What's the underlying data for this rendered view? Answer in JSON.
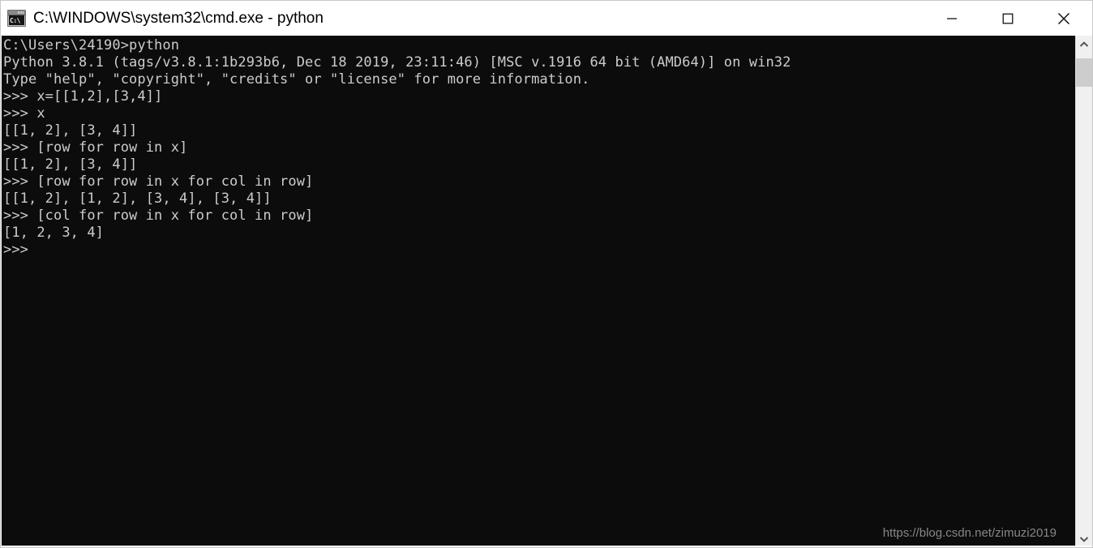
{
  "window": {
    "title": "C:\\WINDOWS\\system32\\cmd.exe - python",
    "icon_name": "cmd-exe-icon",
    "icon_glyph": "C:\\",
    "background_color": "#0c0c0c",
    "text_color": "#cccccc",
    "titlebar_color": "#ffffff"
  },
  "controls": {
    "minimize_label": "Minimize",
    "maximize_label": "Maximize",
    "close_label": "Close"
  },
  "console": {
    "lines": [
      "C:\\Users\\24190>python",
      "Python 3.8.1 (tags/v3.8.1:1b293b6, Dec 18 2019, 23:11:46) [MSC v.1916 64 bit (AMD64)] on win32",
      "Type \"help\", \"copyright\", \"credits\" or \"license\" for more information.",
      ">>> x=[[1,2],[3,4]]",
      ">>> x",
      "[[1, 2], [3, 4]]",
      ">>> [row for row in x]",
      "[[1, 2], [3, 4]]",
      ">>> [row for row in x for col in row]",
      "[[1, 2], [1, 2], [3, 4], [3, 4]]",
      ">>> [col for row in x for col in row]",
      "[1, 2, 3, 4]",
      ">>>"
    ]
  },
  "watermark": {
    "text": "https://blog.csdn.net/zimuzi2019"
  },
  "scrollbar": {
    "up_arrow_name": "chevron-up-icon",
    "down_arrow_name": "chevron-down-icon",
    "thumb_color": "#cdcdcd",
    "track_color": "#f0f0f0"
  }
}
